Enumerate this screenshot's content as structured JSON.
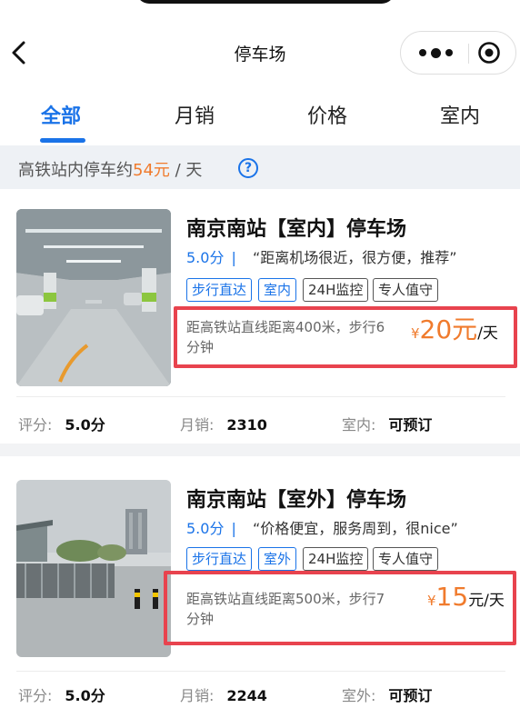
{
  "nav": {
    "title": "停车场",
    "back_icon": "chevron-left-icon",
    "more_icon": "more-dots-icon",
    "close_icon": "target-close-icon"
  },
  "tabs": [
    {
      "label": "全部",
      "active": true
    },
    {
      "label": "月销",
      "active": false
    },
    {
      "label": "价格",
      "active": false
    },
    {
      "label": "室内",
      "active": false
    }
  ],
  "banner": {
    "prefix": "高铁站内停车约",
    "price": "54元",
    "suffix": " / 天",
    "help_label": "?"
  },
  "colors": {
    "accent": "#1a73e8",
    "price": "#f07b2d",
    "highlight": "#e8434e"
  },
  "lots": [
    {
      "name": "南京南站【室内】停车场",
      "score": "5.0分",
      "separator": "|",
      "review": "“距离机场很近，很方便，推荐”",
      "tags": [
        "步行直达",
        "室内",
        "24H监控",
        "专人值守"
      ],
      "distance_line1": "距高铁站直线距离400米，步行6",
      "distance_line2": "分钟",
      "currency": "¥",
      "price": "20元",
      "price_unit": "/天",
      "stats": {
        "rating_label": "评分:",
        "rating_value": "5.0分",
        "sales_label": "月销:",
        "sales_value": "2310",
        "type_label": "室内:",
        "type_value": "可预订"
      }
    },
    {
      "name": "南京南站【室外】停车场",
      "score": "5.0分",
      "separator": "|",
      "review": "“价格便宜，服务周到，很nice”",
      "tags": [
        "步行直达",
        "室外",
        "24H监控",
        "专人值守"
      ],
      "distance_line1": "距高铁站直线距离500米，步行7",
      "distance_line2": "分钟",
      "currency": "¥",
      "price": "15",
      "price_unit": "元/天",
      "stats": {
        "rating_label": "评分:",
        "rating_value": "5.0分",
        "sales_label": "月销:",
        "sales_value": "2244",
        "type_label": "室外:",
        "type_value": "可预订"
      }
    }
  ]
}
